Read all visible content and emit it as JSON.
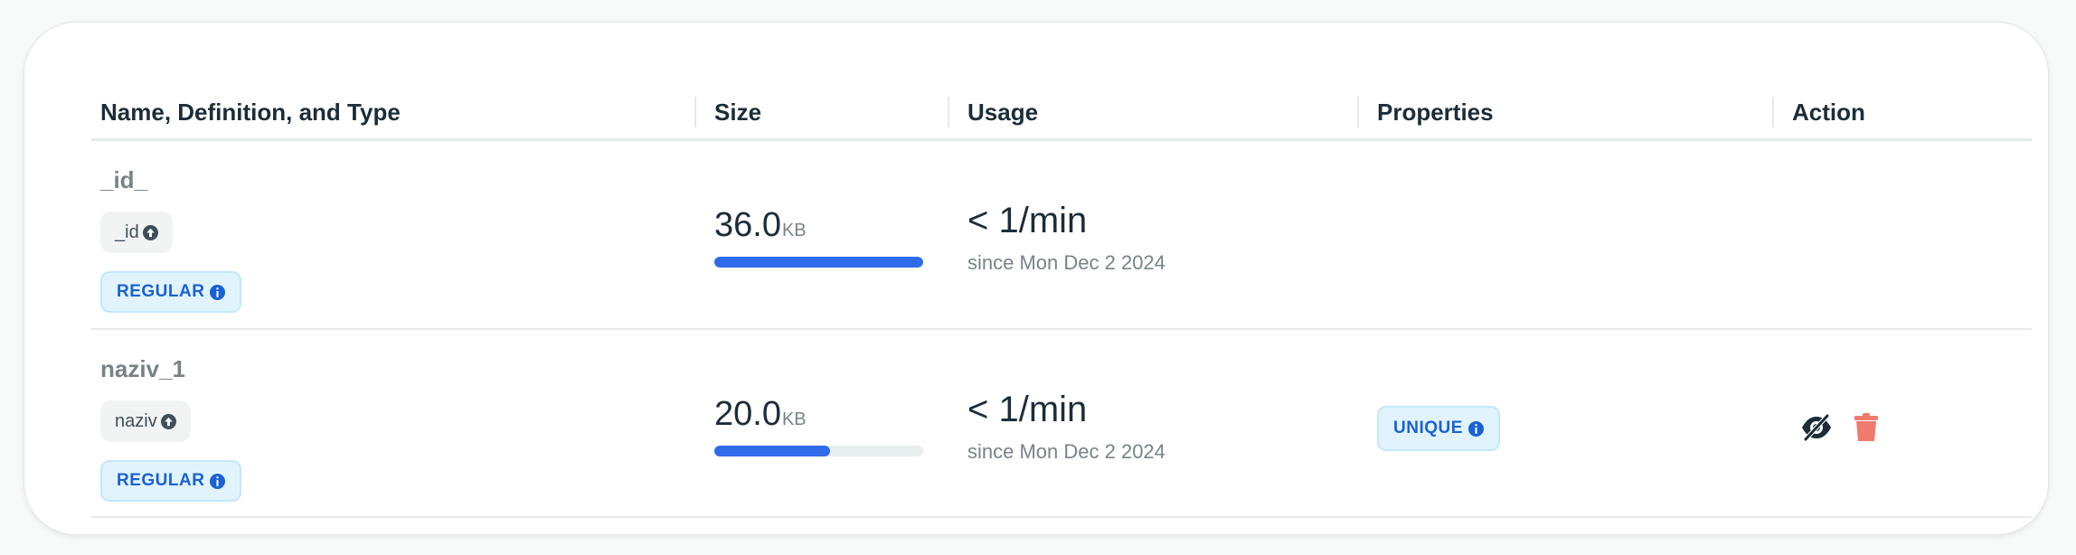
{
  "table": {
    "columns": [
      "Name, Definition, and Type",
      "Size",
      "Usage",
      "Properties",
      "Action"
    ],
    "rows": [
      {
        "name": "_id_",
        "field": "_id",
        "type": "REGULAR",
        "size_value": "36.0",
        "size_unit": "KB",
        "size_fraction": 1.0,
        "usage": "< 1/min",
        "usage_since": "since Mon Dec 2 2024",
        "properties": [],
        "actions": []
      },
      {
        "name": "naziv_1",
        "field": "naziv",
        "type": "REGULAR",
        "size_value": "20.0",
        "size_unit": "KB",
        "size_fraction": 0.556,
        "usage": "< 1/min",
        "usage_since": "since Mon Dec 2 2024",
        "properties": [
          "UNIQUE"
        ],
        "actions": [
          "hide-index-icon",
          "trash-icon"
        ]
      }
    ]
  },
  "icons": {
    "field_direction": "arrow-up-circle-icon",
    "type_info": "info-icon"
  },
  "colors": {
    "accent_blue": "#1a61d4",
    "bar_fill": "#2f6bea",
    "badge_bg": "#e1f4fd",
    "trash": "#f07a6e"
  }
}
